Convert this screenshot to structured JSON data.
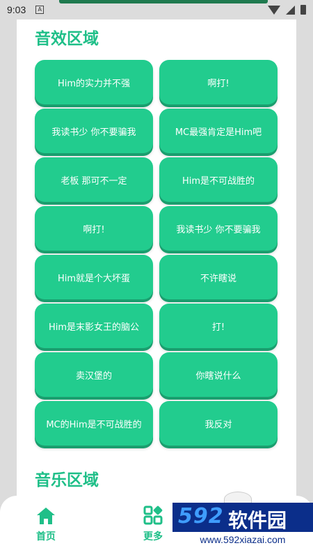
{
  "status_bar": {
    "time": "9:03",
    "a_icon": "A"
  },
  "sections": {
    "sound_title": "音效区域",
    "music_title": "音乐区域"
  },
  "sound_buttons": [
    "Him的实力并不强",
    "啊打!",
    "我读书少 你不要骗我",
    "MC最强肯定是Him吧",
    "老板 那可不一定",
    "Him是不可战胜的",
    "啊打!",
    "我读书少 你不要骗我",
    "Him就是个大坏蛋",
    "不许瞎说",
    "Him是末影女王的脑公",
    "打!",
    "卖汉堡的",
    "你瞎说什么",
    "MC的Him是不可战胜的",
    "我反对"
  ],
  "nav": {
    "home_label": "首页",
    "more_label": "更多"
  },
  "watermark": {
    "number": "592",
    "name": "软件园",
    "url": "www.592xiazai.com"
  },
  "colors": {
    "accent": "#22cc8e",
    "title": "#1fbf88",
    "watermark_bg": "#0b2e8a"
  },
  "icons": [
    "wifi-icon",
    "signal-icon",
    "battery-icon",
    "home-icon",
    "more-icon"
  ]
}
